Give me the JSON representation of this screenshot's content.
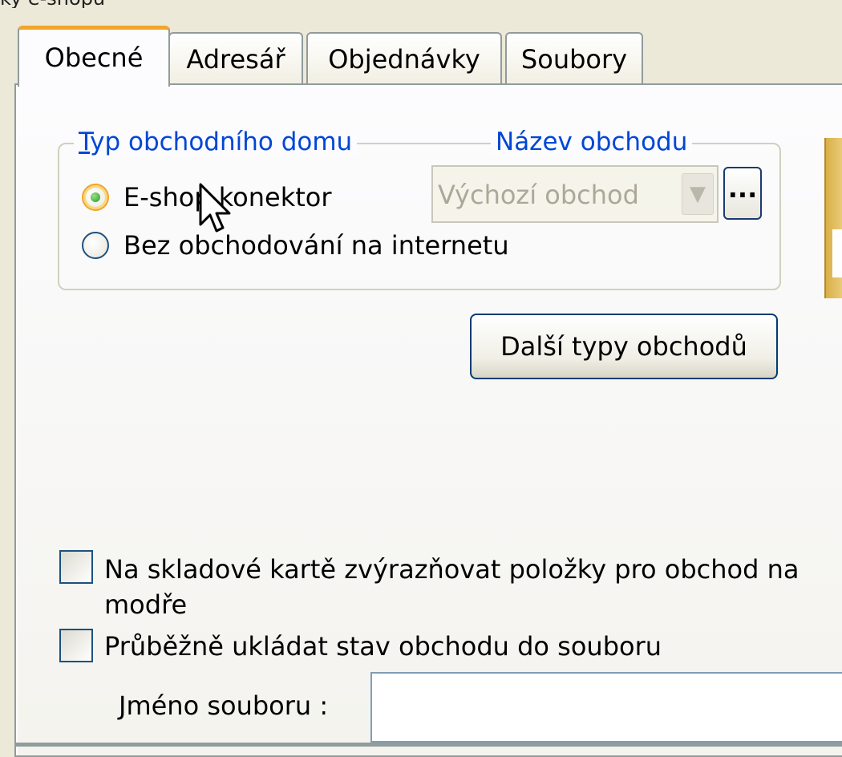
{
  "window": {
    "caption_fragment": "ky e-shopu"
  },
  "tabs": [
    {
      "label": "Obecné",
      "active": true
    },
    {
      "label": "Adresář",
      "active": false
    },
    {
      "label": "Objednávky",
      "active": false
    },
    {
      "label": "Soubory",
      "active": false
    }
  ],
  "store_type_group": {
    "legend": "Typ obchodního domu",
    "options": [
      {
        "label": "E-shop konektor",
        "checked": true
      },
      {
        "label": "Bez obchodování na internetu",
        "checked": false
      }
    ]
  },
  "store_name": {
    "legend": "Název obchodu",
    "value": "Výchozí obchod",
    "browse_label": "..."
  },
  "more_store_types_button": "Další typy obchodů",
  "options": {
    "highlight_items": {
      "label_line1": "Na skladové kartě zvýrazňovat položky pro obchod na",
      "label_line2": "modře",
      "checked": false
    },
    "save_state": {
      "label": "Průběžně ukládat stav obchodu do souboru",
      "checked": false
    }
  },
  "file_name": {
    "label": "Jméno souboru :",
    "value": ""
  },
  "colors": {
    "accent_tab": "#f0a52c",
    "legend_text": "#0046d5",
    "panel_bg": "#fcfcfe"
  },
  "icons": [
    "radio-checked-icon",
    "radio-unchecked-icon",
    "dropdown-arrow-icon",
    "mouse-cursor-icon"
  ]
}
